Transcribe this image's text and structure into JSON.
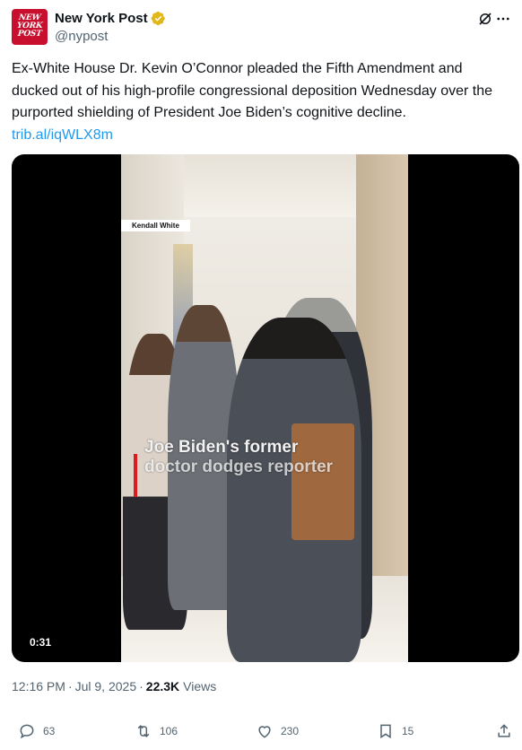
{
  "account": {
    "display_name": "New York Post",
    "handle": "@nypost",
    "avatar_text": [
      "NEW",
      "YORK",
      "POST"
    ],
    "verified_color": "#e2b719",
    "icons": [
      "grok-icon",
      "more-icon"
    ]
  },
  "tweet": {
    "text": "Ex-White House Dr. Kevin O’Connor pleaded the Fifth Amendment and ducked out of his high-profile congressional deposition Wednesday over the purported shielding of President Joe Biden’s cognitive decline.",
    "link": "trib.al/iqWLX8m"
  },
  "video": {
    "credit": "Kendall White",
    "caption_line1": "Joe Biden's former",
    "caption_line2": "doctor dodges reporter",
    "duration": "0:31",
    "accent_color": "#e0191e"
  },
  "meta": {
    "time": "12:16 PM",
    "separator": "·",
    "date": "Jul 9, 2025",
    "separator2": "·",
    "views_count": "22.3K",
    "views_label": "Views"
  },
  "actions": {
    "replies": "63",
    "reposts": "106",
    "likes": "230",
    "bookmarks": "15"
  },
  "colors": {
    "link": "#1d9bf0",
    "secondary_text": "#536471",
    "brand_red": "#c8102e"
  }
}
